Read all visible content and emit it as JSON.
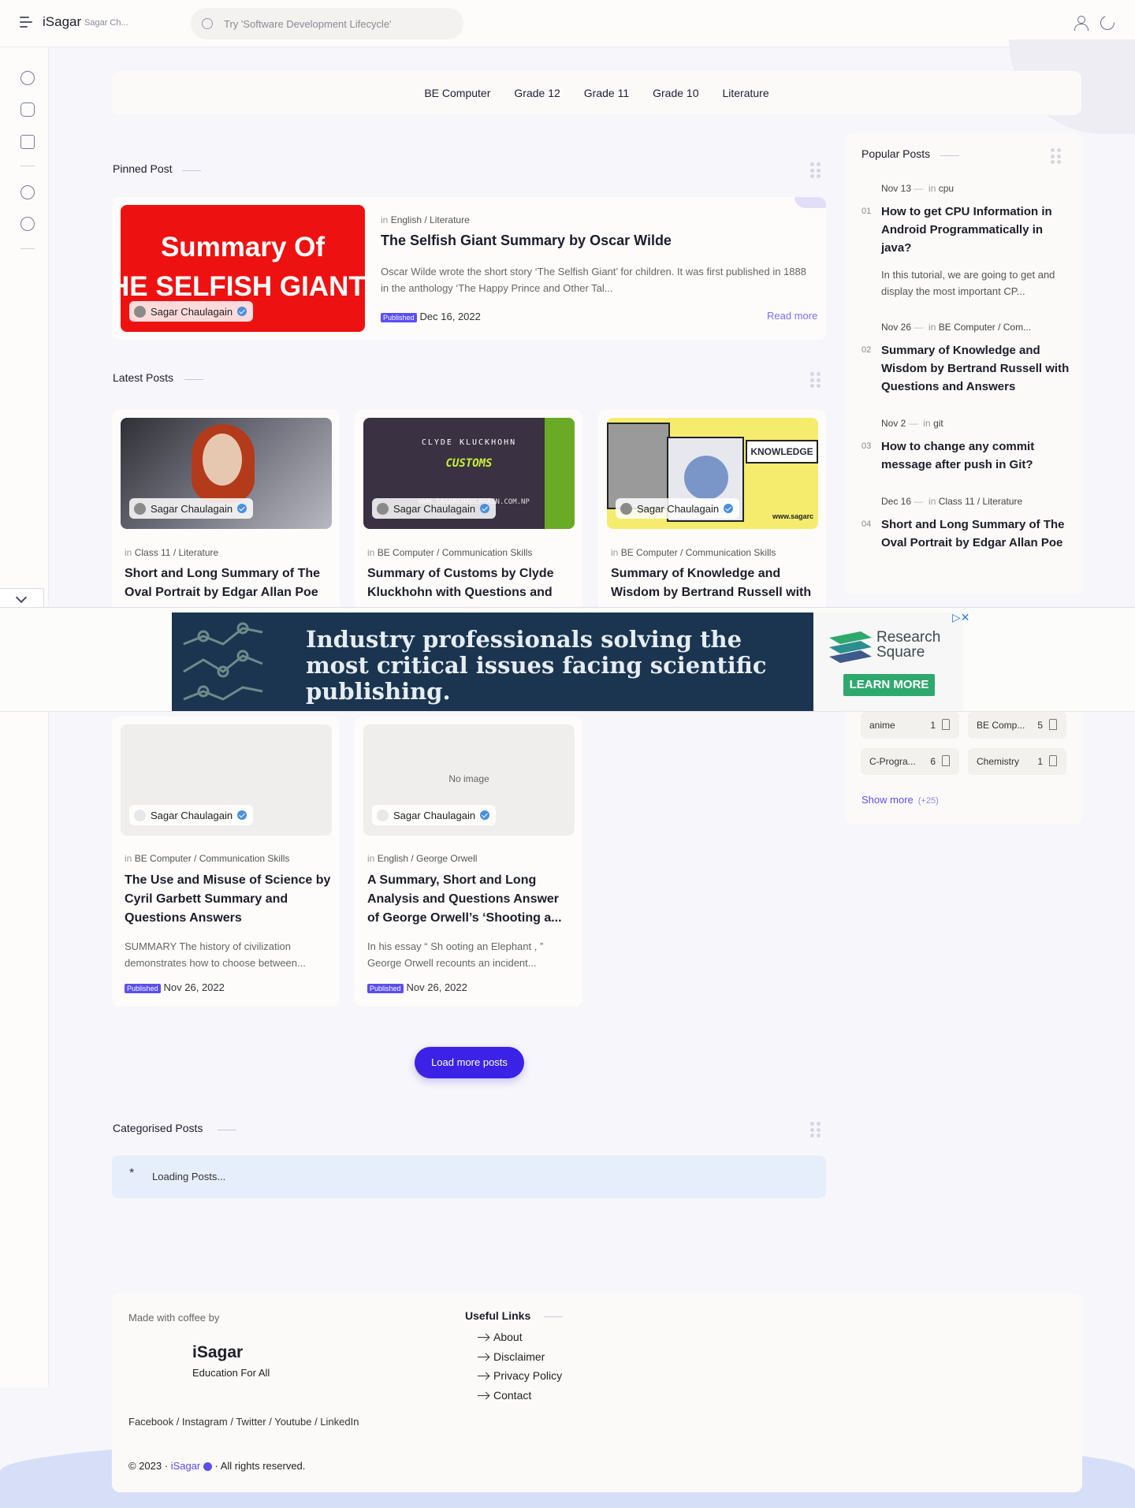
{
  "header": {
    "brand": "iSagar",
    "brand_sub": "Sagar Ch...",
    "search_placeholder": "Try 'Software Development Lifecycle'"
  },
  "nav": [
    "BE Computer",
    "Grade 12",
    "Grade 11",
    "Grade 10",
    "Literature"
  ],
  "pinned": {
    "section_title": "Pinned Post",
    "thumb_line1": "Summary Of",
    "thumb_line2": "HE SELFISH GIANT",
    "author": "Sagar Chaulagain",
    "in": "in",
    "category": "English / Literature",
    "title": "The Selfish Giant Summary by Oscar Wilde",
    "excerpt": "Oscar Wilde wrote the short story ‘The Selfish Giant’ for children. It was first published in 1888 in the anthology ‘The Happy Prince and Other Tal...",
    "badge": "Published",
    "date": "Dec 16, 2022",
    "read_more": "Read more"
  },
  "latest": {
    "section_title": "Latest Posts",
    "posts": [
      {
        "author": "Sagar Chaulagain",
        "category": "Class 11 / Literature",
        "title": "Short and Long Summary of The Oval Portrait by Edgar Allan Poe"
      },
      {
        "author": "Sagar Chaulagain",
        "category": "BE Computer / Communication Skills",
        "title": "Summary of Customs by Clyde Kluckhohn with Questions and",
        "thumb_name": "CLYDE KLUCKHOHN",
        "thumb_word": "CUSTOMS",
        "thumb_url": "WWW.SAGARCHAULAGAIN.COM.NP"
      },
      {
        "author": "Sagar Chaulagain",
        "category": "BE Computer / Communication Skills",
        "title": "Summary of Knowledge and Wisdom by Bertrand Russell with",
        "thumb_word": "KNOWLEDGE",
        "thumb_url": "www.sagarc"
      },
      {
        "author": "Sagar Chaulagain",
        "category": "BE Computer / Communication Skills",
        "title": "The Use and Misuse of Science by Cyril Garbett Summary and Questions Answers",
        "excerpt": "SUMMARY The history of civilization demonstrates how to choose between...",
        "badge": "Published",
        "date": "Nov 26, 2022"
      },
      {
        "author": "Sagar Chaulagain",
        "category": "English / George Orwell",
        "title": "A Summary, Short and Long Analysis and Questions Answer of George Orwell’s ‘Shooting a...",
        "excerpt": "In his essay “ Sh ooting an Elephant , ” George Orwell recounts an incident...",
        "badge": "Published",
        "date": "Nov 26, 2022",
        "no_image": "No image"
      }
    ],
    "load_more": "Load more posts"
  },
  "popular": {
    "title": "Popular Posts",
    "items": [
      {
        "date": "Nov 13",
        "cat": "cpu",
        "num": "01",
        "title": "How to get CPU Information in Android Programmatically in java?",
        "excerpt": "In this tutorial, we are going to get and display the most important CP..."
      },
      {
        "date": "Nov 26",
        "cat": "BE Computer / Com...",
        "num": "02",
        "title": "Summary of Knowledge and Wisdom by Bertrand Russell with Questions and Answers"
      },
      {
        "date": "Nov 2",
        "cat": "git",
        "num": "03",
        "title": "How to change any commit message after push in Git?"
      },
      {
        "date": "Dec 16",
        "cat": "Class 11 / Literature",
        "num": "04",
        "title": "Short and Long Summary of The Oval Portrait by Edgar Allan Poe"
      }
    ]
  },
  "labels": {
    "items": [
      {
        "name": "anime",
        "count": "1"
      },
      {
        "name": "BE Comp...",
        "count": "5"
      },
      {
        "name": "C-Progra...",
        "count": "6"
      },
      {
        "name": "Chemistry",
        "count": "1"
      }
    ],
    "show_more": "Show more",
    "show_more_count": "(+25)"
  },
  "ad": {
    "headline": "Industry professionals solving the most critical issues facing scientific publishing.",
    "logo_line1": "Research",
    "logo_line2": "Square",
    "cta": "LEARN MORE"
  },
  "categorised": {
    "section_title": "Categorised Posts",
    "spinner": "*",
    "loading": "Loading Posts..."
  },
  "footer": {
    "made_with": "Made with coffee by",
    "brand": "iSagar",
    "tagline": "Education For All",
    "useful_links_title": "Useful Links",
    "links": [
      "About",
      "Disclaimer",
      "Privacy Policy",
      "Contact"
    ],
    "social": "Facebook / Instagram / Twitter / Youtube / LinkedIn",
    "copyright_pre": "© 2023 ·",
    "copyright_brand": "iSagar",
    "copyright_post": "· All rights reserved."
  },
  "colors": {
    "accent": "#3b22e6",
    "badge": "#5a4ff0",
    "link": "#7b6ff5",
    "ad_bg": "#1b3550",
    "ad_cta": "#2fa86e"
  }
}
